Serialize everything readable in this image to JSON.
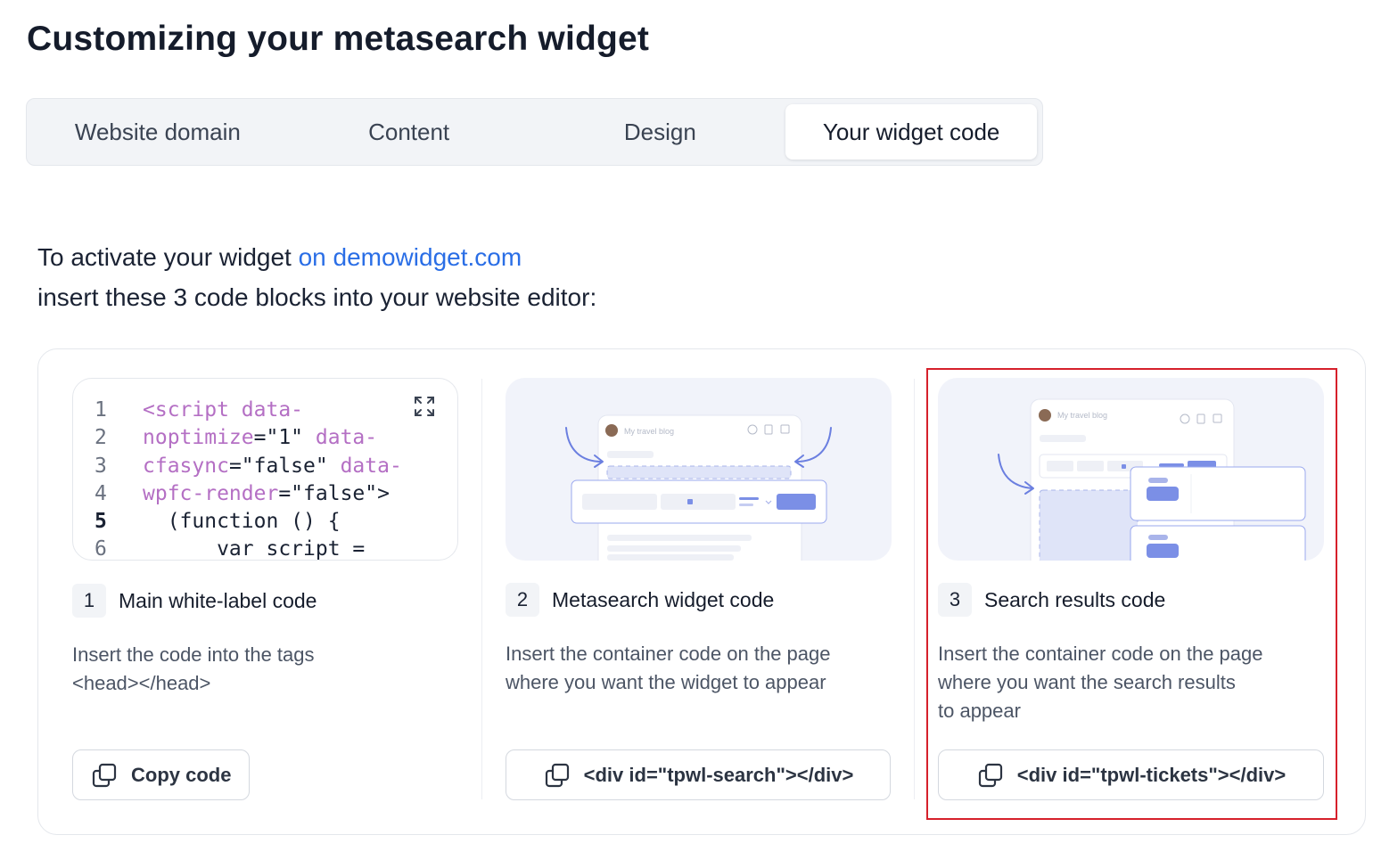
{
  "title": "Customizing your metasearch widget",
  "tabs": [
    {
      "label": "Website domain",
      "active": false
    },
    {
      "label": "Content",
      "active": false
    },
    {
      "label": "Design",
      "active": false
    },
    {
      "label": "Your widget code",
      "active": true
    }
  ],
  "intro": {
    "prefix": "To activate your widget ",
    "link": "on demowidget.com",
    "line2": "insert these 3 code blocks into your website editor:"
  },
  "code_preview": {
    "line_numbers": [
      "1",
      "2",
      "3",
      "4",
      "5",
      "6"
    ],
    "lines": [
      {
        "tag1": "<script data-",
        "s1": "",
        "tag2": ""
      },
      {
        "tag1": "noptimize",
        "s1": "=\"1\" ",
        "tag2": "data-"
      },
      {
        "tag1": "cfasync",
        "s1": "=\"false\" ",
        "tag2": "data-"
      },
      {
        "tag1": "wpfc-render",
        "s1": "=\"false\">",
        "tag2": ""
      },
      {
        "tag1": "",
        "s1": "  (function () {",
        "tag2": ""
      },
      {
        "tag1": "",
        "s1": "      var script =",
        "tag2": ""
      }
    ]
  },
  "preview": {
    "blog_title": "My travel blog"
  },
  "steps": [
    {
      "number": "1",
      "title": "Main white-label code",
      "description_lines": [
        "Insert the code into the tags",
        "<head></head>"
      ],
      "button": "Copy code"
    },
    {
      "number": "2",
      "title": "Metasearch widget code",
      "description_lines": [
        "Insert the container code on the page",
        "where you want the widget to appear"
      ],
      "button": "<div id=\"tpwl-search\"></div>"
    },
    {
      "number": "3",
      "title": "Search results code",
      "description_lines": [
        "Insert the container code on the page",
        "where you want the search results",
        "to appear"
      ],
      "button": "<div id=\"tpwl-tickets\"></div>"
    }
  ],
  "colors": {
    "accent_link": "#2a6ee6",
    "code_tag": "#b46fc4",
    "highlight": "#d6202b",
    "illustration_blue": "#7b8fe6"
  },
  "icons": [
    "expand-icon",
    "copy-icon",
    "arrow-icon",
    "avatar-icon"
  ]
}
